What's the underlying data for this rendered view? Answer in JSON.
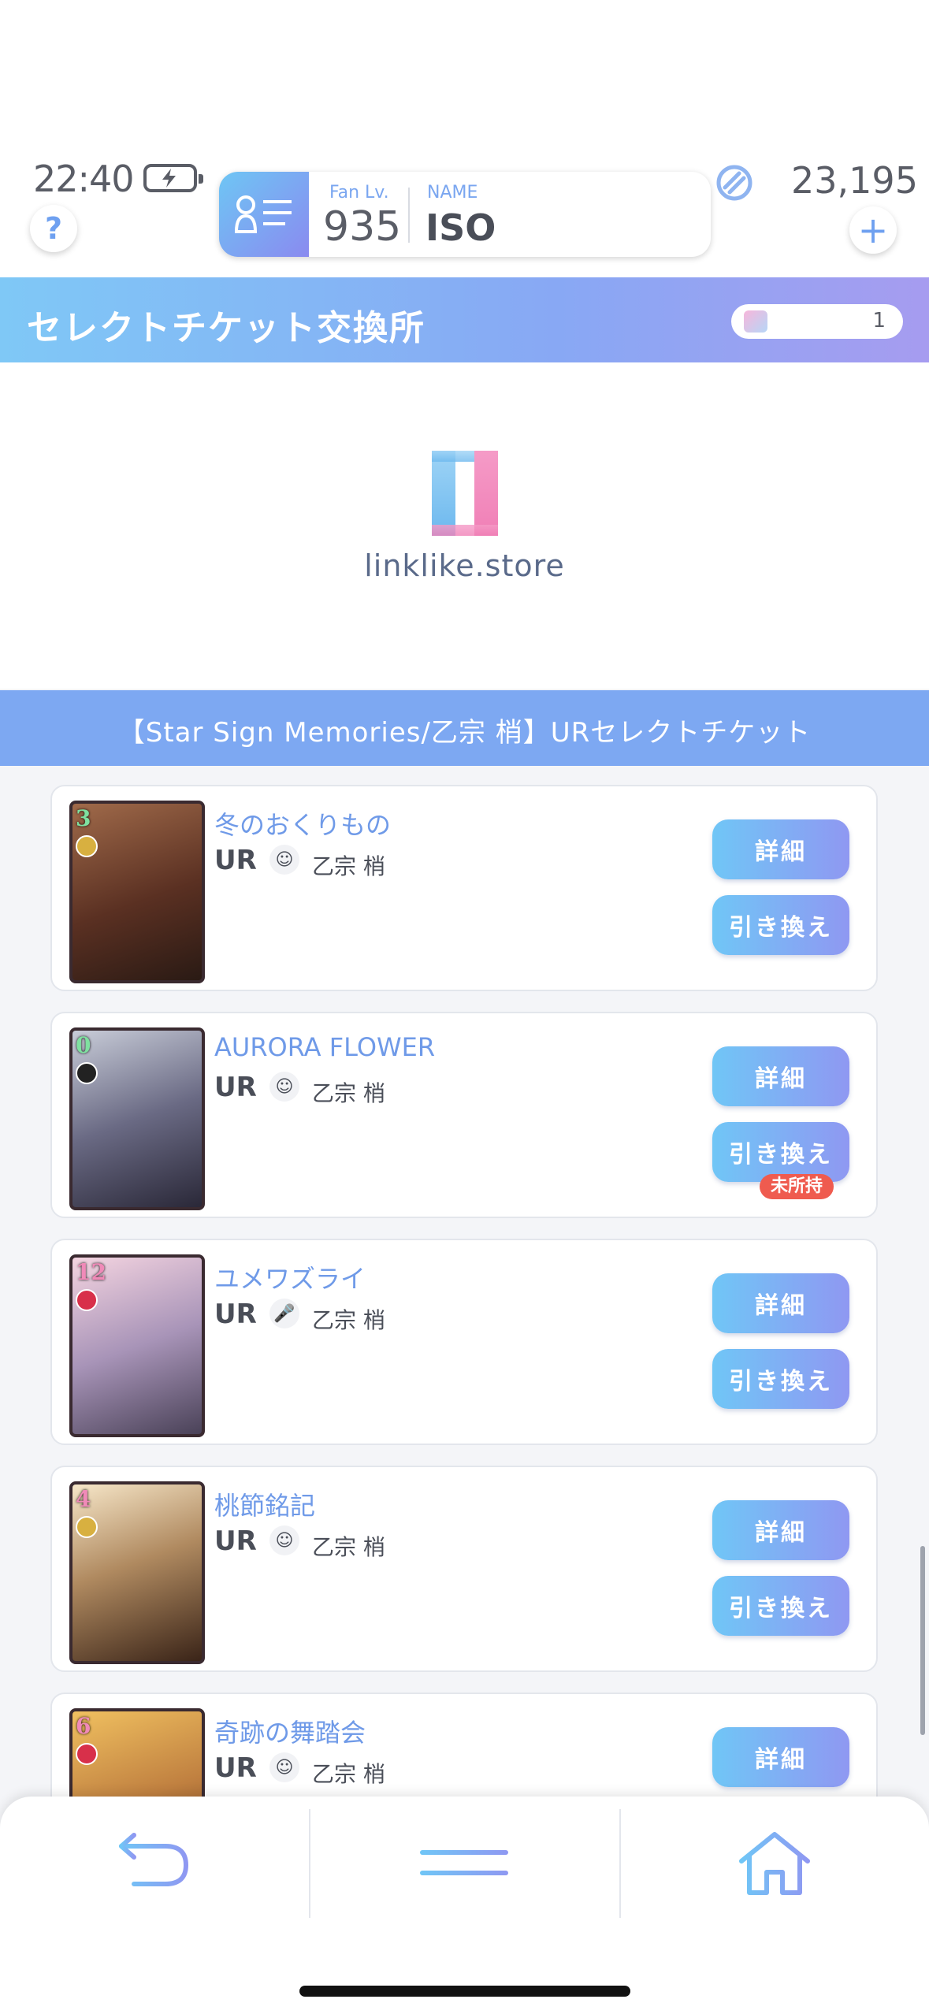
{
  "status_bar": {
    "time": "22:40"
  },
  "profile": {
    "fan_label": "Fan Lv.",
    "fan_level": "935",
    "name_label": "NAME",
    "name": "ISO"
  },
  "currency": {
    "amount": "23,195"
  },
  "header": {
    "title": "セレクトチケット交換所",
    "ticket_count": "1"
  },
  "store": {
    "logo_text": "linklike.store"
  },
  "ticket_title": "【Star Sign Memories/乙宗 梢】URセレクトチケット",
  "cards": [
    {
      "cost": "3",
      "name": "冬のおくりもの",
      "rarity": "UR",
      "member": "乙宗 梢",
      "detail_label": "詳細",
      "exchange_label": "引き換え",
      "cost_color": "#7fe0a0",
      "theme": "#6b3b2c"
    },
    {
      "cost": "0",
      "name": "AURORA FLOWER",
      "rarity": "UR",
      "member": "乙宗 梢",
      "detail_label": "詳細",
      "exchange_label": "引き換え",
      "not_owned": "未所持",
      "cost_color": "#7fe0a0",
      "theme": "#3c3a52"
    },
    {
      "cost": "12",
      "name": "ユメワズライ",
      "rarity": "UR",
      "member": "乙宗 梢",
      "detail_label": "詳細",
      "exchange_label": "引き換え",
      "cost_color": "#f08ab8",
      "theme": "#8a7a9a"
    },
    {
      "cost": "4",
      "name": "桃節銘記",
      "rarity": "UR",
      "member": "乙宗 梢",
      "detail_label": "詳細",
      "exchange_label": "引き換え",
      "cost_color": "#f08ab8",
      "theme": "#7a5a40"
    },
    {
      "cost": "6",
      "name": "奇跡の舞踏会",
      "rarity": "UR",
      "member": "乙宗 梢",
      "detail_label": "詳細",
      "cost_color": "#f08ab8",
      "theme": "#b07a40"
    }
  ],
  "icons": {
    "help": "help-icon",
    "plus": "plus-icon",
    "back": "back-arrow-icon",
    "menu": "menu-icon",
    "home": "home-icon"
  },
  "colors": {
    "accent_blue": "#7da8f2",
    "gradient_start": "#70c6f6",
    "gradient_end": "#8f98f2",
    "not_owned_red": "#ef5b4f"
  }
}
